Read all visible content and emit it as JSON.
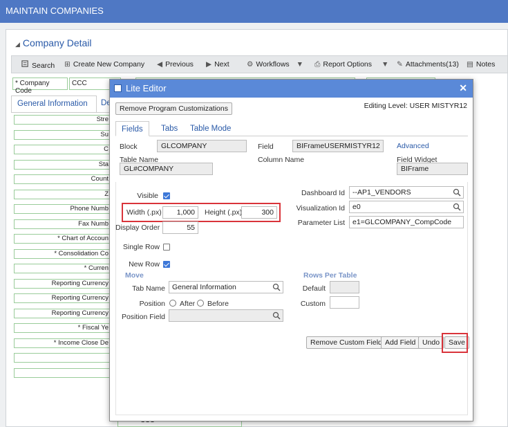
{
  "app": {
    "title": "MAINTAIN COMPANIES"
  },
  "detail": {
    "title": "Company Detail"
  },
  "toolbar": {
    "search": "Search",
    "create": "Create New Company",
    "previous": "Previous",
    "next": "Next",
    "workflows": "Workflows",
    "report_options": "Report Options",
    "attachments": "Attachments(13)",
    "notes": "Notes"
  },
  "company_code": {
    "label": "* Company Code",
    "value": "CCC"
  },
  "bg_tabs": {
    "general": "General Information",
    "other": "De"
  },
  "bg_rows": [
    "Stre",
    "Su",
    "C",
    "Sta",
    "Count",
    "Z",
    "Phone Numb",
    "Fax Numb",
    "* Chart of Accoun",
    "* Consolidation Co",
    "* Curren",
    "Reporting Currency",
    "Reporting Currency",
    "Reporting Currency",
    "* Fiscal Ye",
    "* Income Close De",
    "",
    ""
  ],
  "bg_bottom_value": "CCC",
  "dialog": {
    "title": "Lite Editor",
    "remove_customizations": "Remove Program Customizations",
    "editing_level_label": "Editing Level:",
    "editing_level_value": "USER  MISTYR12",
    "tabs": {
      "fields": "Fields",
      "tabs": "Tabs",
      "table_mode": "Table Mode"
    },
    "block_label": "Block",
    "block_value": "GLCOMPANY",
    "field_label": "Field",
    "field_value": "BIFrameUSERMISTYR12",
    "advanced": "Advanced",
    "table_name_label": "Table Name",
    "table_name_value": "GL#COMPANY",
    "column_name_label": "Column Name",
    "field_widget_label": "Field Widget",
    "field_widget_value": "BIFrame",
    "visible_label": "Visible",
    "width_label": "Width (.px)",
    "width_value": "1,000",
    "height_label": "Height (.px)",
    "height_value": "300",
    "display_order_label": "Display Order",
    "display_order_value": "55",
    "single_row_label": "Single Row",
    "new_row_label": "New Row",
    "move_label": "Move",
    "tab_name_label": "Tab Name",
    "tab_name_value": "General Information",
    "position_label": "Position",
    "after_label": "After",
    "before_label": "Before",
    "position_field_label": "Position Field",
    "dashboard_id_label": "Dashboard Id",
    "dashboard_id_value": "--AP1_VENDORS",
    "visualization_id_label": "Visualization Id",
    "visualization_id_value": "e0",
    "parameter_list_label": "Parameter List",
    "parameter_list_value": "e1=GLCOMPANY_CompCode",
    "rows_per_table_label": "Rows Per Table",
    "default_label": "Default",
    "custom_label": "Custom",
    "remove_custom_field": "Remove Custom Field",
    "add_field": "Add Field",
    "undo": "Undo",
    "save": "Save"
  },
  "colors": {
    "header": "#4f78c4",
    "dialog_title": "#5a89d8",
    "highlight": "#d9333a",
    "checkbox": "#3d78d8"
  },
  "icons": [
    "search-icon",
    "create-icon",
    "previous-arrow-icon",
    "next-arrow-icon",
    "workflows-icon",
    "print-icon",
    "attachment-icon",
    "notes-icon",
    "close-icon",
    "app-icon",
    "chevron-down-icon"
  ]
}
